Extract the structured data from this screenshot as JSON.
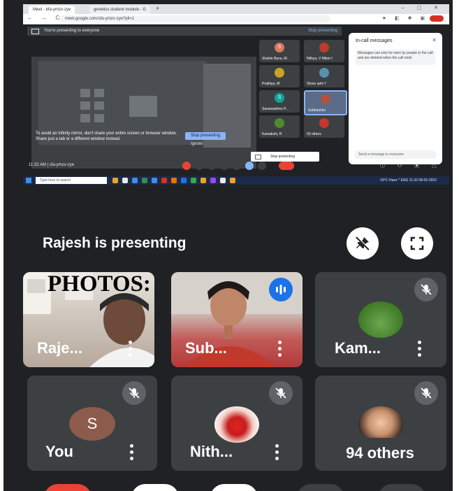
{
  "browser": {
    "tab1": "Meet - bfa-ymzv-zye",
    "tab2": "genetics student module - G",
    "new_tab": "+",
    "window_controls": "–  ▢  ✕",
    "url": "meet.google.com/sfa-ymzv-zye?pli=1",
    "nav": "← → C"
  },
  "shared_meet": {
    "banner_text": "You're presenting to everyone",
    "banner_stop": "Stop presenting",
    "warning": "To avoid an infinity mirror, don't share your entire screen or browser window. Share just a tab or a different window instead.",
    "stop_button": "Stop presenting",
    "ignore": "Ignore",
    "popup_item": "Stop presenting",
    "time": "11:32 AM | sfa-ymzv-zye",
    "tiles": [
      {
        "name": "Shahin Banu, M..",
        "initial": "S",
        "color": "#d9785d"
      },
      {
        "name": "Nithya, V Mitun I",
        "initial": "",
        "color": "#c0392b"
      },
      {
        "name": "Prathiya, M",
        "initial": "",
        "color": "#c9a227"
      },
      {
        "name": "Shree ashi T",
        "initial": "",
        "color": "#5b8fb0"
      },
      {
        "name": "Saraswathivs P...",
        "initial": "S",
        "color": "#12a39b"
      },
      {
        "name": "Subhashini",
        "initial": "",
        "color": "#b3523b"
      },
      {
        "name": "Kamakshi, R",
        "initial": "",
        "color": "#4f8a2c"
      },
      {
        "name": "93 others",
        "initial": "",
        "color": "#c0392b"
      }
    ],
    "chat_title": "In-call messages",
    "chat_close": "✕",
    "chat_note": "Messages can only be seen by people in the call and are deleted when the call ends",
    "chat_input": "Send a message to everyone",
    "taskbar_search": "Type here to search",
    "taskbar_right": "29°C Haze  ^  ENG  11:32  08-02-2022"
  },
  "meet": {
    "presenting_text": "Rajesh is presenting",
    "participants": [
      {
        "name": "Raje...",
        "type": "photo"
      },
      {
        "name": "Sub...",
        "type": "photo"
      },
      {
        "name": "Kam...",
        "type": "avatar"
      },
      {
        "name": "You",
        "type": "initial",
        "initial": "S"
      },
      {
        "name": "Nith...",
        "type": "avatar"
      },
      {
        "name": "94 others",
        "type": "avatar"
      }
    ]
  },
  "overlay": {
    "label": "PHOTOS:"
  }
}
